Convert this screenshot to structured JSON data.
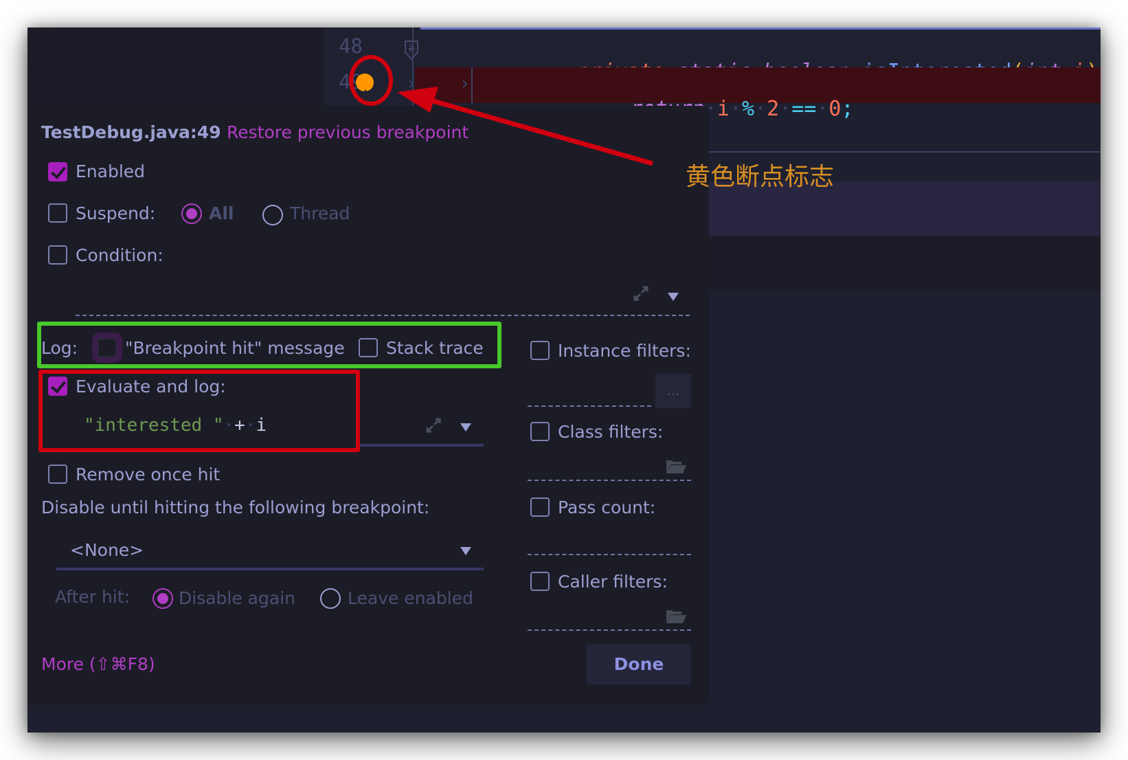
{
  "editor": {
    "lines": [
      {
        "number": "48",
        "tokens": [
          "private",
          "static",
          "boolean",
          "isInterested",
          "(",
          "int",
          "i",
          ")",
          "{"
        ]
      },
      {
        "number": "49",
        "tokens": [
          "return",
          "i",
          "%",
          "2",
          "==",
          "0",
          ";"
        ],
        "highlighted": true
      }
    ],
    "breakpoint_color": "#ff9800",
    "highlight_color": "#3d0d13"
  },
  "popup": {
    "location": "TestDebug.java:49",
    "restore_link": "Restore previous breakpoint",
    "enabled": {
      "label": "Enabled",
      "checked": true
    },
    "suspend": {
      "label": "Suspend:",
      "checked": false,
      "options": [
        "All",
        "Thread"
      ],
      "selected": "All"
    },
    "condition": {
      "label": "Condition:",
      "checked": false,
      "value": ""
    },
    "log": {
      "label": "Log:",
      "breakpoint_hit": {
        "label": "\"Breakpoint hit\" message",
        "checked": false
      },
      "stack_trace": {
        "label": "Stack trace",
        "checked": false
      }
    },
    "evaluate": {
      "label": "Evaluate and log:",
      "checked": true,
      "expression_string": "\"interested \"",
      "expression_op": "+",
      "expression_var": "i"
    },
    "remove_once_hit": {
      "label": "Remove once hit",
      "checked": false
    },
    "disable_until": {
      "label": "Disable until hitting the following breakpoint:",
      "selected": "<None>"
    },
    "after_hit": {
      "label": "After hit:",
      "options": [
        "Disable again",
        "Leave enabled"
      ],
      "selected": "Disable again"
    },
    "filters": {
      "instance": {
        "label": "Instance filters:",
        "checked": false,
        "button": "..."
      },
      "class": {
        "label": "Class filters:",
        "checked": false
      },
      "pass_count": {
        "label": "Pass count:",
        "checked": false
      },
      "caller": {
        "label": "Caller filters:",
        "checked": false
      }
    },
    "more_link": "More (⇧⌘F8)",
    "done_button": "Done"
  },
  "annotation": {
    "text": "黄色断点标志",
    "colors": {
      "red": "#d0000f",
      "green": "#47c82b",
      "text": "#d88f22"
    }
  },
  "theme": {
    "accent": "#b13ec5",
    "label": "#9a9fd0"
  }
}
